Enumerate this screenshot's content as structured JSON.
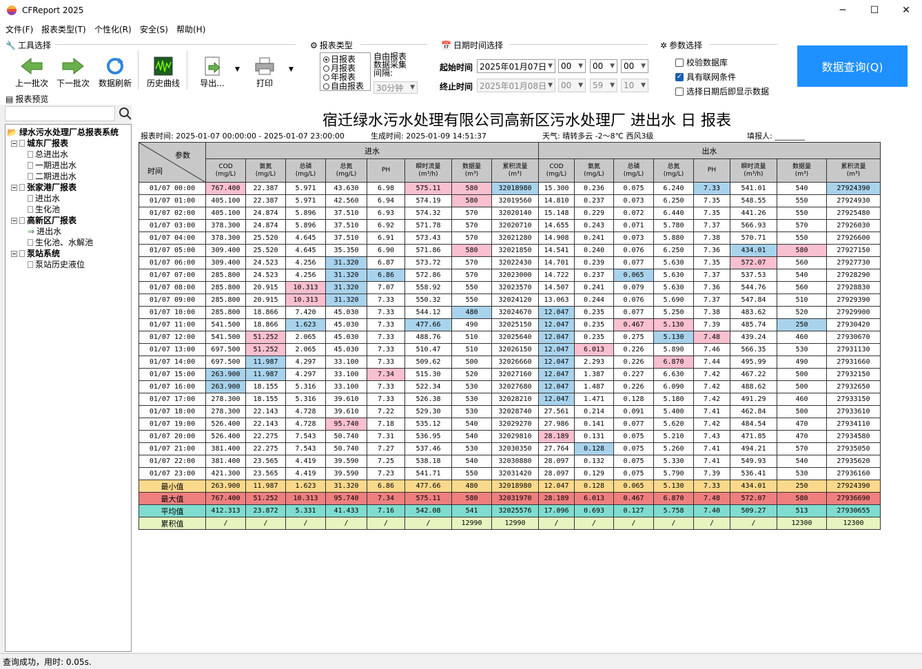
{
  "window": {
    "title": "CFReport 2025",
    "min": "─",
    "max": "☐",
    "close": "✕"
  },
  "menu": [
    "文件(F)",
    "报表类型(T)",
    "个性化(R)",
    "安全(S)",
    "帮助(H)"
  ],
  "toolbar": {
    "group_title": "工具选择",
    "prev_batch": "上一批次",
    "next_batch": "下一批次",
    "refresh": "数据刷新",
    "history_curve": "历史曲线",
    "export": "导出...",
    "print": "打印",
    "report_preview": "报表预览"
  },
  "report_type": {
    "title": "报表类型",
    "options": [
      "日报表",
      "月报表",
      "年报表",
      "自由报表"
    ],
    "selected": "日报表",
    "free_label": "自由报表数据采集间隔:",
    "interval": "30分钟"
  },
  "datetime": {
    "title": "日期时间选择",
    "start_label": "起始时间",
    "start_date": "2025年01月07日",
    "start_h": "00",
    "start_m": "00",
    "start_s": "00",
    "end_label": "终止时间",
    "end_date": "2025年01月08日",
    "end_h": "00",
    "end_m": "59",
    "end_s": "10"
  },
  "params": {
    "title": "参数选择",
    "items": [
      {
        "label": "校验数据库",
        "checked": false
      },
      {
        "label": "具有联网条件",
        "checked": true
      },
      {
        "label": "选择日期后即显示数据",
        "checked": false
      }
    ]
  },
  "query_button": "数据查询(Q)",
  "tree": {
    "root": "绿水污水处理厂总报表系统",
    "groups": [
      {
        "label": "城东厂报表",
        "items": [
          "总进出水",
          "一期进出水",
          "二期进出水"
        ]
      },
      {
        "label": "张家港厂报表",
        "items": [
          "进出水",
          "生化池"
        ]
      },
      {
        "label": "高新区厂报表",
        "items": [
          "进出水",
          "生化池、水解池"
        ]
      },
      {
        "label": "泵站系统",
        "items": [
          "泵站历史液位"
        ]
      }
    ]
  },
  "report": {
    "title": "宿迁绿水污水处理有限公司高新区污水处理厂 进出水 日 报表",
    "report_time": "报表时间: 2025-01-07 00:00:00 - 2025-01-07 23:00:00",
    "gen_time": "生成时间: 2025-01-09  14:51:37",
    "weather": "天气: 晴转多云  -2～8℃  西风3级",
    "filler": "填报人: ________",
    "hdr_param": "参数",
    "hdr_time": "时间",
    "hdr_in": "进水",
    "hdr_out": "出水",
    "columns": [
      "COD\n(mg/L)",
      "氨氮\n(mg/L)",
      "总磷\n(mg/L)",
      "总氮\n(mg/L)",
      "PH",
      "瞬时流量\n(m³/h)",
      "数据量\n(m³)",
      "累积流量\n(m³)",
      "COD\n(mg/L)",
      "氨氮\n(mg/L)",
      "总磷\n(mg/L)",
      "总氮\n(mg/L)",
      "PH",
      "瞬时流量\n(m³/h)",
      "数据量\n(m³)",
      "累积流量\n(m³)"
    ],
    "rows": [
      [
        "01/07 00:00",
        "767.400",
        "22.387",
        "5.971",
        "43.630",
        "6.98",
        "575.11",
        "580",
        "32018980",
        "15.300",
        "0.236",
        "0.075",
        "6.240",
        "7.33",
        "541.01",
        "540",
        "27924390"
      ],
      [
        "01/07 01:00",
        "405.100",
        "22.387",
        "5.971",
        "42.560",
        "6.94",
        "574.19",
        "580",
        "32019560",
        "14.810",
        "0.237",
        "0.073",
        "6.250",
        "7.35",
        "548.55",
        "550",
        "27924930"
      ],
      [
        "01/07 02:00",
        "405.100",
        "24.874",
        "5.896",
        "37.510",
        "6.93",
        "574.32",
        "570",
        "32020140",
        "15.148",
        "0.229",
        "0.072",
        "6.440",
        "7.35",
        "441.26",
        "550",
        "27925480"
      ],
      [
        "01/07 03:00",
        "378.300",
        "24.874",
        "5.896",
        "37.510",
        "6.92",
        "571.78",
        "570",
        "32020710",
        "14.655",
        "0.243",
        "0.071",
        "5.780",
        "7.37",
        "566.93",
        "570",
        "27926030"
      ],
      [
        "01/07 04:00",
        "378.300",
        "25.520",
        "4.645",
        "37.510",
        "6.91",
        "573.43",
        "570",
        "32021280",
        "14.908",
        "0.241",
        "0.073",
        "5.880",
        "7.38",
        "570.71",
        "550",
        "27926600"
      ],
      [
        "01/07 05:00",
        "309.400",
        "25.520",
        "4.645",
        "35.350",
        "6.90",
        "571.86",
        "580",
        "32021850",
        "14.541",
        "0.240",
        "0.076",
        "6.250",
        "7.36",
        "434.01",
        "580",
        "27927150"
      ],
      [
        "01/07 06:00",
        "309.400",
        "24.523",
        "4.256",
        "31.320",
        "6.87",
        "573.72",
        "570",
        "32022430",
        "14.701",
        "0.239",
        "0.077",
        "5.630",
        "7.35",
        "572.07",
        "560",
        "27927730"
      ],
      [
        "01/07 07:00",
        "285.800",
        "24.523",
        "4.256",
        "31.320",
        "6.86",
        "572.86",
        "570",
        "32023000",
        "14.722",
        "0.237",
        "0.065",
        "5.630",
        "7.37",
        "537.53",
        "540",
        "27928290"
      ],
      [
        "01/07 08:00",
        "285.800",
        "20.915",
        "10.313",
        "31.320",
        "7.07",
        "558.92",
        "550",
        "32023570",
        "14.507",
        "0.241",
        "0.079",
        "5.630",
        "7.36",
        "544.76",
        "560",
        "27928830"
      ],
      [
        "01/07 09:00",
        "285.800",
        "20.915",
        "10.313",
        "31.320",
        "7.33",
        "550.32",
        "550",
        "32024120",
        "13.063",
        "0.244",
        "0.076",
        "5.690",
        "7.37",
        "547.84",
        "510",
        "27929390"
      ],
      [
        "01/07 10:00",
        "285.800",
        "18.866",
        "7.420",
        "45.030",
        "7.33",
        "544.12",
        "480",
        "32024670",
        "12.047",
        "0.235",
        "0.077",
        "5.250",
        "7.38",
        "483.62",
        "520",
        "27929900"
      ],
      [
        "01/07 11:00",
        "541.500",
        "18.866",
        "1.623",
        "45.030",
        "7.33",
        "477.66",
        "490",
        "32025150",
        "12.047",
        "0.235",
        "0.467",
        "5.130",
        "7.39",
        "485.74",
        "250",
        "27930420"
      ],
      [
        "01/07 12:00",
        "541.500",
        "51.252",
        "2.065",
        "45.030",
        "7.33",
        "488.76",
        "510",
        "32025640",
        "12.047",
        "0.235",
        "0.275",
        "5.130",
        "7.48",
        "439.24",
        "460",
        "27930670"
      ],
      [
        "01/07 13:00",
        "697.500",
        "51.252",
        "2.065",
        "45.030",
        "7.33",
        "510.47",
        "510",
        "32026150",
        "12.047",
        "6.013",
        "0.226",
        "5.890",
        "7.46",
        "566.35",
        "530",
        "27931130"
      ],
      [
        "01/07 14:00",
        "697.500",
        "11.987",
        "4.297",
        "33.100",
        "7.33",
        "509.62",
        "500",
        "32026660",
        "12.047",
        "2.293",
        "0.226",
        "6.870",
        "7.44",
        "495.99",
        "490",
        "27931660"
      ],
      [
        "01/07 15:00",
        "263.900",
        "11.987",
        "4.297",
        "33.100",
        "7.34",
        "515.30",
        "520",
        "32027160",
        "12.047",
        "1.387",
        "0.227",
        "6.630",
        "7.42",
        "467.22",
        "500",
        "27932150"
      ],
      [
        "01/07 16:00",
        "263.900",
        "18.155",
        "5.316",
        "33.100",
        "7.33",
        "522.34",
        "530",
        "32027680",
        "12.047",
        "1.487",
        "0.226",
        "6.090",
        "7.42",
        "488.62",
        "500",
        "27932650"
      ],
      [
        "01/07 17:00",
        "278.300",
        "18.155",
        "5.316",
        "39.610",
        "7.33",
        "526.38",
        "530",
        "32028210",
        "12.047",
        "1.471",
        "0.128",
        "5.180",
        "7.42",
        "491.29",
        "460",
        "27933150"
      ],
      [
        "01/07 18:00",
        "278.300",
        "22.143",
        "4.728",
        "39.610",
        "7.22",
        "529.30",
        "530",
        "32028740",
        "27.561",
        "0.214",
        "0.091",
        "5.400",
        "7.41",
        "462.84",
        "500",
        "27933610"
      ],
      [
        "01/07 19:00",
        "526.400",
        "22.143",
        "4.728",
        "95.740",
        "7.18",
        "535.12",
        "540",
        "32029270",
        "27.986",
        "0.141",
        "0.077",
        "5.620",
        "7.42",
        "484.54",
        "470",
        "27934110"
      ],
      [
        "01/07 20:00",
        "526.400",
        "22.275",
        "7.543",
        "50.740",
        "7.31",
        "536.95",
        "540",
        "32029810",
        "28.189",
        "0.131",
        "0.075",
        "5.210",
        "7.43",
        "471.85",
        "470",
        "27934580"
      ],
      [
        "01/07 21:00",
        "381.400",
        "22.275",
        "7.543",
        "50.740",
        "7.27",
        "537.46",
        "530",
        "32030350",
        "27.764",
        "0.128",
        "0.075",
        "5.260",
        "7.41",
        "494.21",
        "570",
        "27935050"
      ],
      [
        "01/07 22:00",
        "381.400",
        "23.565",
        "4.419",
        "39.590",
        "7.25",
        "538.18",
        "540",
        "32030880",
        "28.097",
        "0.132",
        "0.075",
        "5.330",
        "7.41",
        "549.93",
        "540",
        "27935620"
      ],
      [
        "01/07 23:00",
        "421.300",
        "23.565",
        "4.419",
        "39.590",
        "7.23",
        "541.71",
        "550",
        "32031420",
        "28.097",
        "0.129",
        "0.075",
        "5.790",
        "7.39",
        "536.41",
        "530",
        "27936160"
      ]
    ],
    "highlights": {
      "pink": [
        [
          0,
          1
        ],
        [
          0,
          6
        ],
        [
          0,
          7
        ],
        [
          1,
          7
        ],
        [
          5,
          7
        ],
        [
          5,
          15
        ],
        [
          6,
          14
        ],
        [
          8,
          3
        ],
        [
          9,
          3
        ],
        [
          12,
          2
        ],
        [
          13,
          2
        ],
        [
          13,
          10
        ],
        [
          14,
          12
        ],
        [
          15,
          5
        ],
        [
          19,
          4
        ],
        [
          20,
          9
        ],
        [
          11,
          11
        ],
        [
          11,
          12
        ],
        [
          12,
          13
        ]
      ],
      "blue": [
        [
          0,
          8
        ],
        [
          0,
          13
        ],
        [
          0,
          16
        ],
        [
          6,
          4
        ],
        [
          7,
          4
        ],
        [
          7,
          5
        ],
        [
          7,
          11
        ],
        [
          8,
          4
        ],
        [
          9,
          4
        ],
        [
          10,
          7
        ],
        [
          10,
          9
        ],
        [
          11,
          3
        ],
        [
          11,
          6
        ],
        [
          11,
          9
        ],
        [
          11,
          12
        ],
        [
          11,
          15
        ],
        [
          12,
          9
        ],
        [
          12,
          12
        ],
        [
          13,
          9
        ],
        [
          14,
          2
        ],
        [
          14,
          9
        ],
        [
          15,
          1
        ],
        [
          15,
          2
        ],
        [
          15,
          9
        ],
        [
          16,
          1
        ],
        [
          16,
          9
        ],
        [
          17,
          9
        ],
        [
          21,
          10
        ],
        [
          5,
          14
        ]
      ]
    },
    "summary": [
      {
        "kind": "min",
        "label": "最小值",
        "values": [
          "263.900",
          "11.987",
          "1.623",
          "31.320",
          "6.86",
          "477.66",
          "480",
          "32018980",
          "12.047",
          "0.128",
          "0.065",
          "5.130",
          "7.33",
          "434.01",
          "250",
          "27924390"
        ]
      },
      {
        "kind": "max",
        "label": "最大值",
        "values": [
          "767.400",
          "51.252",
          "10.313",
          "95.740",
          "7.34",
          "575.11",
          "580",
          "32031970",
          "28.189",
          "6.013",
          "0.467",
          "6.870",
          "7.48",
          "572.07",
          "580",
          "27936690"
        ]
      },
      {
        "kind": "avg",
        "label": "平均值",
        "values": [
          "412.313",
          "23.872",
          "5.331",
          "41.433",
          "7.16",
          "542.08",
          "541",
          "32025576",
          "17.096",
          "0.693",
          "0.127",
          "5.758",
          "7.40",
          "509.27",
          "513",
          "27930655"
        ]
      },
      {
        "kind": "sum",
        "label": "累积值",
        "values": [
          "/",
          "/",
          "/",
          "/",
          "/",
          "/",
          "12990",
          "12990",
          "/",
          "/",
          "/",
          "/",
          "/",
          "/",
          "12300",
          "12300"
        ]
      }
    ]
  },
  "status": "查询成功，用时: 0.05s."
}
